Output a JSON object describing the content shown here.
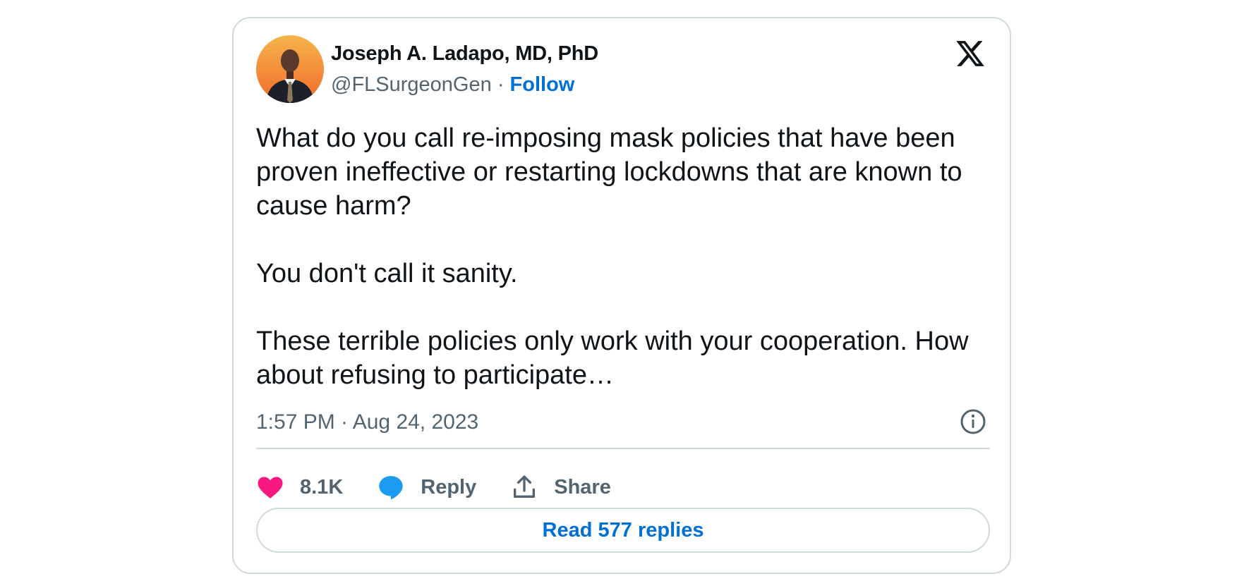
{
  "author": {
    "name": "Joseph A. Ladapo, MD, PhD",
    "handle": "@FLSurgeonGen",
    "separator": "·",
    "follow_label": "Follow"
  },
  "tweet": {
    "paragraphs": [
      "What do you call re-imposing mask policies that have been proven ineffective or restarting lockdowns that are known to cause harm?",
      "You don't call it sanity.",
      "These terrible policies only work with your cooperation. How about refusing to participate…"
    ],
    "timestamp": "1:57 PM · Aug 24, 2023"
  },
  "actions": {
    "like_count": "8.1K",
    "reply_label": "Reply",
    "share_label": "Share"
  },
  "read_replies_label": "Read 577 replies",
  "colors": {
    "accent": "#006fd6",
    "like": "#f91880",
    "reply": "#1d9bf0",
    "muted": "#536471",
    "border": "#cfd9de"
  }
}
